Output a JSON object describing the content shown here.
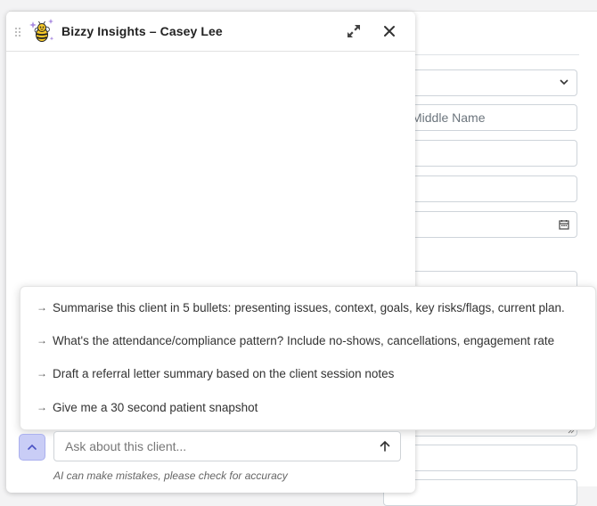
{
  "chat": {
    "title": "Bizzy Insights – Casey Lee",
    "icons": {
      "drag": "drag-handle-icon",
      "logo": "bee-logo-icon",
      "expand": "expand-icon",
      "close": "close-icon"
    }
  },
  "suggestions": [
    {
      "label": "Summarise this client in 5 bullets: presenting issues, context, goals, key risks/flags, current plan."
    },
    {
      "label": "What's the attendance/compliance pattern? Include no-shows, cancellations, engagement rate"
    },
    {
      "label": "Draft a referral letter summary based on the client session notes"
    },
    {
      "label": "Give me a 30 second patient snapshot"
    }
  ],
  "input": {
    "placeholder": "Ask about this client...",
    "disclaimer": "AI can make mistakes, please check for accuracy"
  },
  "background_form": {
    "middle_name_placeholder": "Middle Name"
  },
  "colors": {
    "toggle_bg": "#c9cdf6",
    "accent": "#5a63d8"
  }
}
